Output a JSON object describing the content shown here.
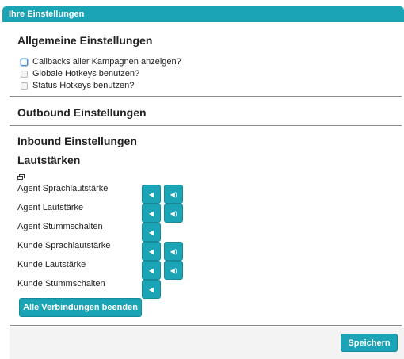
{
  "header": {
    "title": "Ihre Einstellungen"
  },
  "general": {
    "title": "Allgemeine Einstellungen",
    "options": [
      {
        "label": "Callbacks aller Kampagnen anzeigen?",
        "checked": false
      },
      {
        "label": "Globale Hotkeys benutzen?",
        "checked": false
      },
      {
        "label": "Status Hotkeys benutzen?",
        "checked": false
      }
    ]
  },
  "outbound": {
    "title": "Outbound Einstellungen"
  },
  "inbound": {
    "title": "Inbound Einstellungen"
  },
  "volume": {
    "title": "Lautstärken",
    "rows": [
      {
        "label": "Agent Sprachlautstärke"
      },
      {
        "label": "Agent Lautstärke"
      },
      {
        "label": "Agent Stummschalten"
      },
      {
        "label": "Kunde Sprachlautstärke"
      },
      {
        "label": "Kunde Lautstärke"
      },
      {
        "label": "Kunde Stummschalten"
      }
    ],
    "icons": {
      "down": "volume-down-icon",
      "up": "volume-up-icon",
      "mute": "mute-icon"
    }
  },
  "actions": {
    "end_all_label": "Alle Verbindungen beenden",
    "save_label": "Speichern"
  },
  "colors": {
    "accent": "#1aa4b6",
    "divider": "#8a8a8a"
  }
}
